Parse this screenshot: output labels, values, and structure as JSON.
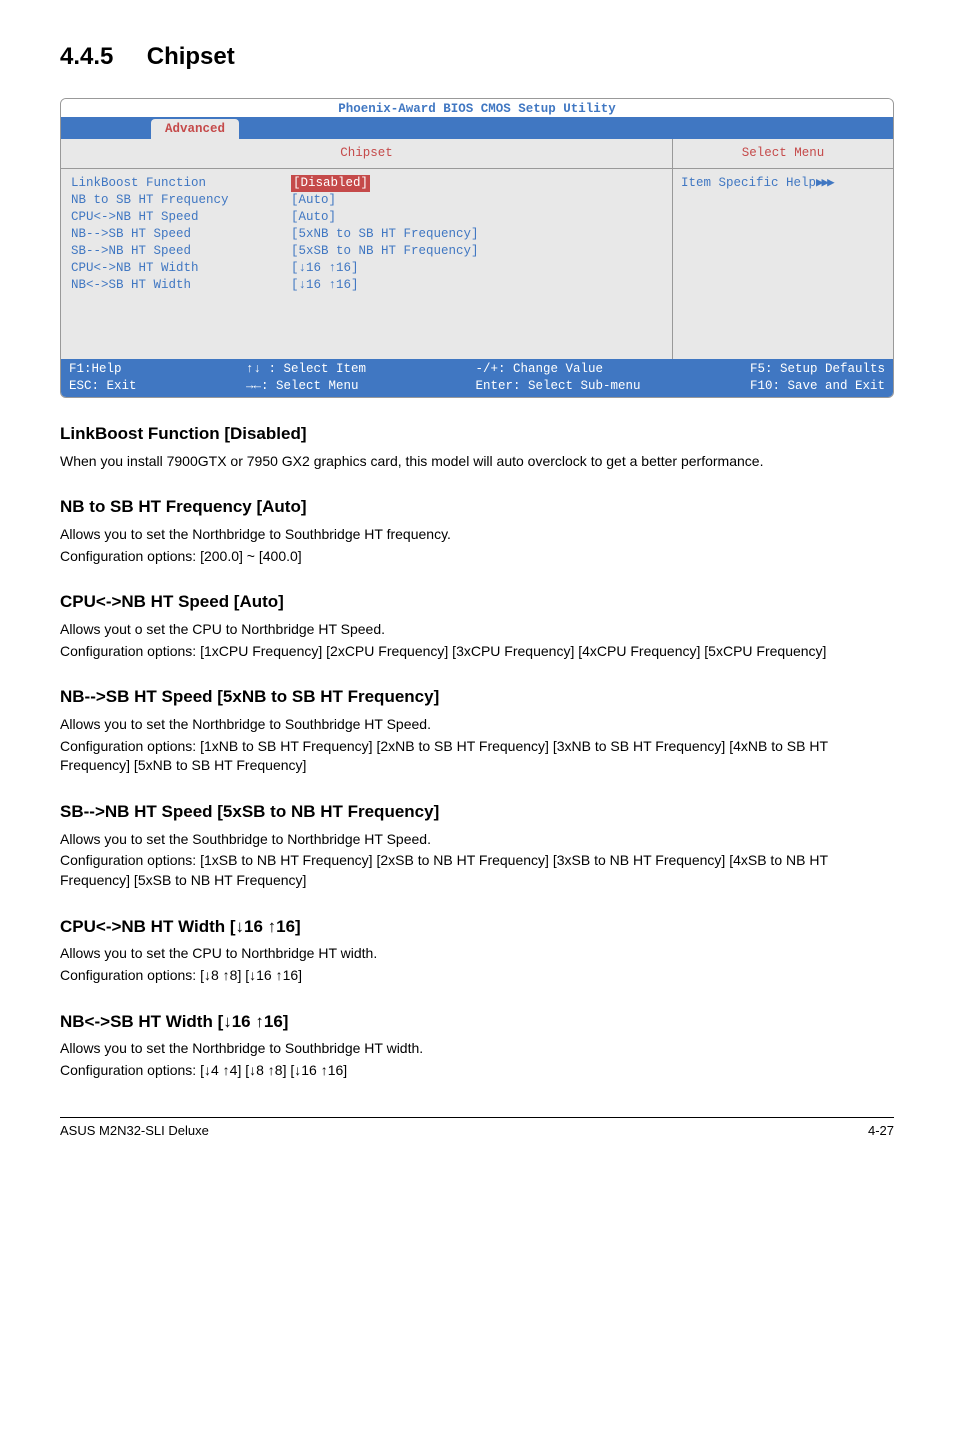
{
  "section": {
    "number": "4.4.5",
    "title": "Chipset"
  },
  "bios": {
    "header": "Phoenix-Award BIOS CMOS Setup Utility",
    "tab": "Advanced",
    "panel_title": "Chipset",
    "right_title": "Select Menu",
    "right_help": "Item Specific Help",
    "right_arrows": "▶▶▶",
    "rows": [
      {
        "label": "LinkBoost Function",
        "value": "[Disabled]",
        "highlight": true
      },
      {
        "label": "NB to SB HT Frequency",
        "value": "[Auto]"
      },
      {
        "label": "CPU<->NB HT Speed",
        "value": "[Auto]"
      },
      {
        "label": "NB-->SB HT Speed",
        "value": "[5xNB to SB HT Frequency]"
      },
      {
        "label": "SB-->NB HT Speed",
        "value": "[5xSB to NB HT Frequency]"
      },
      {
        "label": "CPU<->NB HT Width",
        "value": "[↓16 ↑16]"
      },
      {
        "label": "NB<->SB HT Width",
        "value": "[↓16 ↑16]"
      }
    ],
    "footer": {
      "f1": "F1:Help",
      "esc": "ESC: Exit",
      "sel_item": "↑↓ : Select Item",
      "sel_menu": "→←: Select Menu",
      "change": "-/+: Change Value",
      "enter": "Enter: Select Sub-menu",
      "f5": "F5: Setup Defaults",
      "f10": "F10: Save and Exit"
    }
  },
  "items": [
    {
      "heading": "LinkBoost Function [Disabled]",
      "body": [
        "When you install 7900GTX or 7950 GX2 graphics card, this model will auto overclock to get a better performance."
      ]
    },
    {
      "heading": "NB to SB HT Frequency [Auto]",
      "body": [
        "Allows you to set the Northbridge to Southbridge HT frequency.",
        "Configuration options: [200.0] ~ [400.0]"
      ]
    },
    {
      "heading": "CPU<->NB HT Speed [Auto]",
      "body": [
        "Allows yout o set the CPU to Northbridge HT Speed.",
        "Configuration options: [1xCPU Frequency] [2xCPU Frequency] [3xCPU Frequency] [4xCPU Frequency] [5xCPU Frequency]"
      ]
    },
    {
      "heading": "NB-->SB HT Speed [5xNB to SB HT Frequency]",
      "body": [
        "Allows you to set the Northbridge to Southbridge HT Speed.",
        "Configuration options: [1xNB to SB HT Frequency] [2xNB to SB HT Frequency] [3xNB to SB HT Frequency] [4xNB to SB HT Frequency] [5xNB to SB HT Frequency]"
      ]
    },
    {
      "heading": "SB-->NB HT Speed [5xSB to NB HT Frequency]",
      "body": [
        "Allows you to set the Southbridge to Northbridge HT Speed.",
        "Configuration options: [1xSB to NB HT Frequency] [2xSB to NB HT Frequency] [3xSB to NB HT Frequency] [4xSB to NB HT Frequency] [5xSB to NB HT Frequency]"
      ]
    },
    {
      "heading": "CPU<->NB HT Width [↓16 ↑16]",
      "body": [
        "Allows you to set the CPU to Northbridge HT width.",
        "Configuration options: [↓8 ↑8] [↓16 ↑16]"
      ]
    },
    {
      "heading": "NB<->SB HT Width [↓16 ↑16]",
      "body": [
        "Allows you to set the Northbridge to Southbridge HT width.",
        "Configuration options: [↓4 ↑4] [↓8 ↑8] [↓16 ↑16]"
      ]
    }
  ],
  "footer": {
    "left": "ASUS M2N32-SLI Deluxe",
    "right": "4-27"
  }
}
